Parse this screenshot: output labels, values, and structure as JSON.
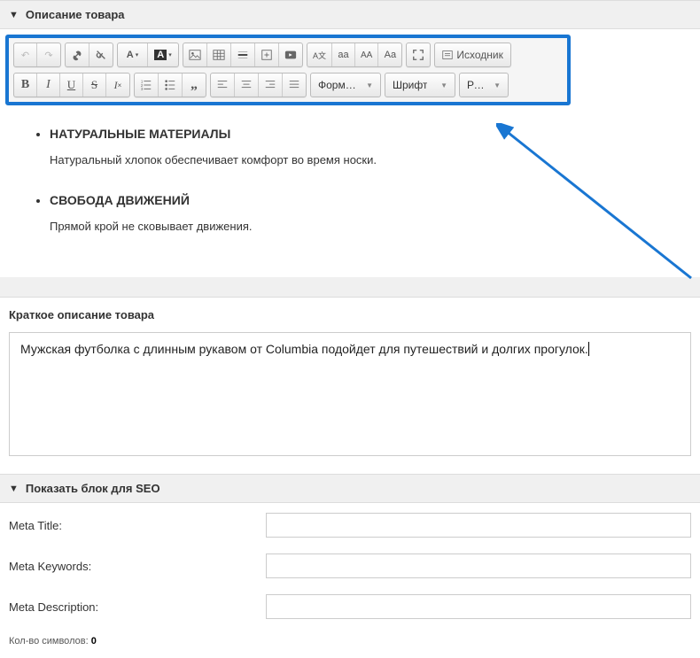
{
  "descPanel": {
    "title": "Описание товара"
  },
  "toolbar": {
    "source": "Исходник",
    "format": "Формат...",
    "font": "Шрифт",
    "size": "Ра...",
    "caseLower": "aa",
    "caseUpper": "AA",
    "caseCap": "Aa"
  },
  "content": {
    "bullet1_title": "НАТУРАЛЬНЫЕ МАТЕРИАЛЫ",
    "bullet1_text": "Натуральный хлопок обеспечивает комфорт во время носки.",
    "bullet2_title": "СВОБОДА ДВИЖЕНИЙ",
    "bullet2_text": "Прямой крой не сковывает движения."
  },
  "shortDesc": {
    "label": "Краткое описание товара",
    "text": "Мужская футболка с длинным рукавом от Columbia подойдет для путешествий и долгих прогулок."
  },
  "seo": {
    "panelTitle": "Показать блок для SEO",
    "metaTitle": "Meta Title:",
    "metaKeywords": "Meta Keywords:",
    "metaDescription": "Meta Description:",
    "charCountLabel": "Кол-во символов: ",
    "charCount": "0"
  }
}
